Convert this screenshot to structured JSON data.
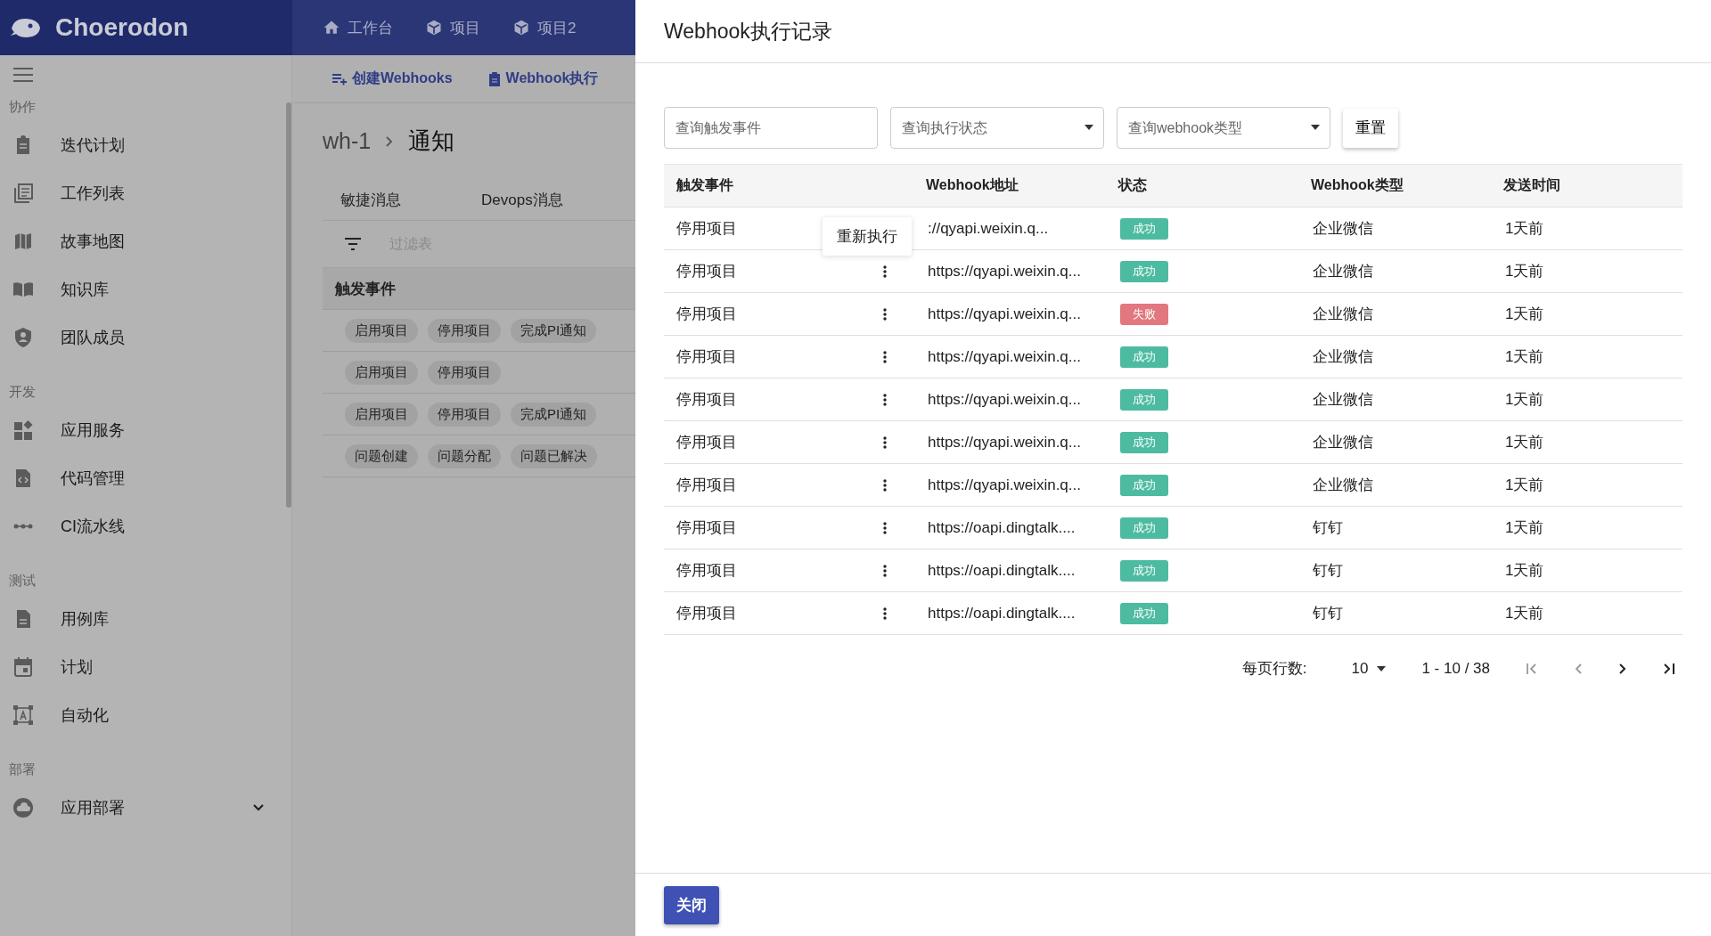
{
  "app": {
    "logo_text": "Choerodon"
  },
  "top_nav": [
    {
      "label": "工作台",
      "kind": "home"
    },
    {
      "label": "项目",
      "kind": "cube"
    },
    {
      "label": "项目2",
      "kind": "cube"
    }
  ],
  "sidebar": {
    "sections": [
      {
        "title": "协作",
        "items": [
          {
            "label": "迭代计划",
            "kind": "clipboard"
          },
          {
            "label": "工作列表",
            "kind": "list"
          },
          {
            "label": "故事地图",
            "kind": "map"
          },
          {
            "label": "知识库",
            "kind": "book"
          },
          {
            "label": "团队成员",
            "kind": "shield"
          }
        ]
      },
      {
        "title": "开发",
        "items": [
          {
            "label": "应用服务",
            "kind": "widgets"
          },
          {
            "label": "代码管理",
            "kind": "code"
          },
          {
            "label": "CI流水线",
            "kind": "pipeline"
          }
        ]
      },
      {
        "title": "测试",
        "items": [
          {
            "label": "用例库",
            "kind": "file"
          },
          {
            "label": "计划",
            "kind": "calendar"
          },
          {
            "label": "自动化",
            "kind": "frame"
          }
        ]
      },
      {
        "title": "部署",
        "items": [
          {
            "label": "应用部署",
            "kind": "cloud",
            "expandable": true
          }
        ]
      }
    ]
  },
  "page": {
    "tabs": [
      {
        "label": "创建Webhooks",
        "kind": "add-list"
      },
      {
        "label": "Webhook执行",
        "kind": "clipboard"
      }
    ],
    "breadcrumb": {
      "parent": "wh-1",
      "current": "通知"
    },
    "sub_tabs": [
      {
        "label": "敏捷消息"
      },
      {
        "label": "Devops消息"
      }
    ],
    "filter": {
      "placeholder": "过滤表"
    },
    "table": {
      "columns": [
        "触发事件"
      ],
      "rows": [
        [
          "启用项目",
          "停用项目",
          "完成PI通知"
        ],
        [
          "启用项目",
          "停用项目"
        ],
        [
          "启用项目",
          "停用项目",
          "完成PI通知"
        ],
        [
          "问题创建",
          "问题分配",
          "问题已解决"
        ]
      ]
    }
  },
  "drawer": {
    "title": "Webhook执行记录",
    "filters": [
      {
        "placeholder": "查询触发事件",
        "kind": "text"
      },
      {
        "placeholder": "查询执行状态",
        "kind": "select"
      },
      {
        "placeholder": "查询webhook类型",
        "kind": "select"
      }
    ],
    "reset_button": "重置",
    "table": {
      "columns": [
        "触发事件",
        "Webhook地址",
        "状态",
        "Webhook类型",
        "发送时间"
      ],
      "rows": [
        {
          "event": "停用项目",
          "menu": false,
          "url": "://qyapi.weixin.q...",
          "status": {
            "label": "成功",
            "kind": "success"
          },
          "type": "企业微信",
          "time": "1天前"
        },
        {
          "event": "停用项目",
          "menu": true,
          "url": "https://qyapi.weixin.q...",
          "status": {
            "label": "成功",
            "kind": "success"
          },
          "type": "企业微信",
          "time": "1天前"
        },
        {
          "event": "停用项目",
          "menu": true,
          "url": "https://qyapi.weixin.q...",
          "status": {
            "label": "失败",
            "kind": "fail"
          },
          "type": "企业微信",
          "time": "1天前"
        },
        {
          "event": "停用项目",
          "menu": true,
          "url": "https://qyapi.weixin.q...",
          "status": {
            "label": "成功",
            "kind": "success"
          },
          "type": "企业微信",
          "time": "1天前"
        },
        {
          "event": "停用项目",
          "menu": true,
          "url": "https://qyapi.weixin.q...",
          "status": {
            "label": "成功",
            "kind": "success"
          },
          "type": "企业微信",
          "time": "1天前"
        },
        {
          "event": "停用项目",
          "menu": true,
          "url": "https://qyapi.weixin.q...",
          "status": {
            "label": "成功",
            "kind": "success"
          },
          "type": "企业微信",
          "time": "1天前"
        },
        {
          "event": "停用项目",
          "menu": true,
          "url": "https://qyapi.weixin.q...",
          "status": {
            "label": "成功",
            "kind": "success"
          },
          "type": "企业微信",
          "time": "1天前"
        },
        {
          "event": "停用项目",
          "menu": true,
          "url": "https://oapi.dingtalk....",
          "status": {
            "label": "成功",
            "kind": "success"
          },
          "type": "钉钉",
          "time": "1天前"
        },
        {
          "event": "停用项目",
          "menu": true,
          "url": "https://oapi.dingtalk....",
          "status": {
            "label": "成功",
            "kind": "success"
          },
          "type": "钉钉",
          "time": "1天前"
        },
        {
          "event": "停用项目",
          "menu": true,
          "url": "https://oapi.dingtalk....",
          "status": {
            "label": "成功",
            "kind": "success"
          },
          "type": "钉钉",
          "time": "1天前"
        }
      ]
    },
    "context_menu": {
      "label": "重新执行"
    },
    "pagination": {
      "rows_label": "每页行数:",
      "rows_per_page": "10",
      "range": "1 - 10 / 38"
    },
    "close_button": "关闭"
  }
}
